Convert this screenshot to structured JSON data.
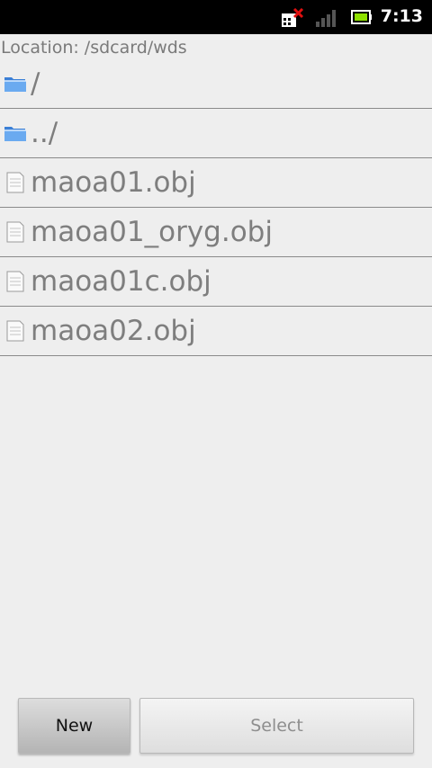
{
  "status_bar": {
    "time": "7:13",
    "icons": [
      "sim-missing-icon",
      "signal-icon",
      "battery-icon"
    ]
  },
  "location": {
    "label": "Location: /sdcard/wds"
  },
  "files": [
    {
      "name": "/",
      "type": "folder",
      "icon": "folder-icon"
    },
    {
      "name": "../",
      "type": "folder",
      "icon": "folder-icon"
    },
    {
      "name": "maoa01.obj",
      "type": "file",
      "icon": "file-icon"
    },
    {
      "name": "maoa01_oryg.obj",
      "type": "file",
      "icon": "file-icon"
    },
    {
      "name": "maoa01c.obj",
      "type": "file",
      "icon": "file-icon"
    },
    {
      "name": "maoa02.obj",
      "type": "file",
      "icon": "file-icon"
    }
  ],
  "buttons": {
    "new_label": "New",
    "select_label": "Select"
  },
  "colors": {
    "background": "#eeeeee",
    "folder_blue": "#4a8fe0",
    "status_bar": "#000000",
    "battery_green": "#8ee000"
  }
}
